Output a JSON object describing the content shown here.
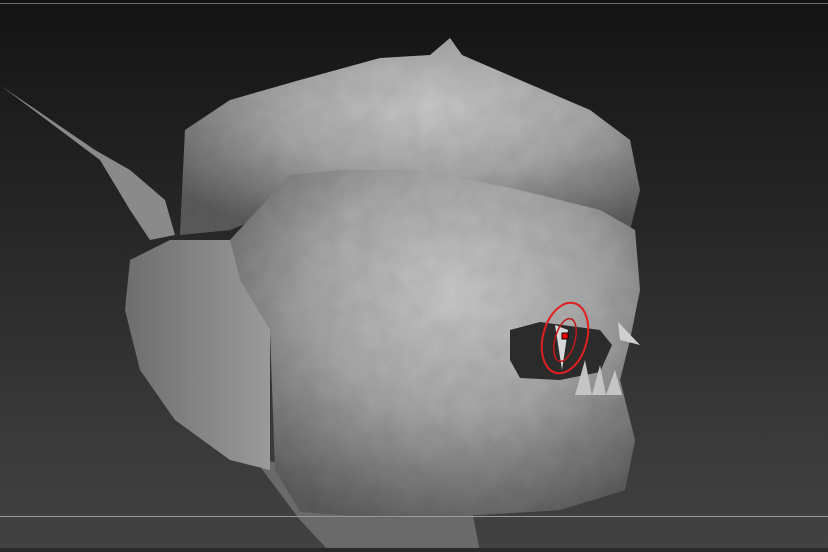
{
  "viewport": {
    "background_top": "#141414",
    "background_bottom": "#424242",
    "model_color": "#a8a8a8"
  },
  "brush_cursor": {
    "outer_ring_color": "#e02020",
    "inner_ring_color": "#c01818",
    "center_marker_color": "#ff0000"
  }
}
